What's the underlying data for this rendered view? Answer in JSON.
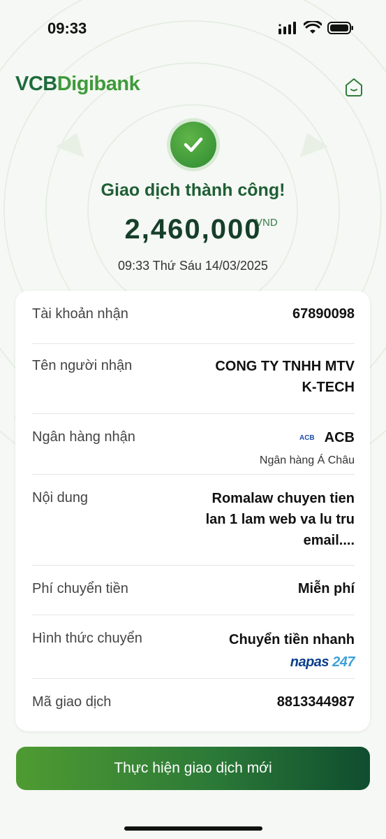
{
  "status_bar": {
    "time": "09:33",
    "icons": [
      "signal-icon",
      "wifi-icon",
      "battery-icon"
    ]
  },
  "header": {
    "logo_vcb": "VCB",
    "logo_digibank": "Digibank",
    "home_icon": "home-icon"
  },
  "result": {
    "title": "Giao dịch thành công!",
    "amount": "2,460,000",
    "currency": "VND",
    "datetime": "09:33 Thứ Sáu 14/03/2025"
  },
  "details": {
    "account": {
      "label": "Tài khoản nhận",
      "value": "67890098"
    },
    "recipient": {
      "label": "Tên người nhận",
      "value_line1": "CONG TY TNHH MTV",
      "value_line2": "K-TECH"
    },
    "bank": {
      "label": "Ngân hàng nhận",
      "logo_text": "ACB",
      "value": "ACB",
      "sub": "Ngân hàng Á Châu"
    },
    "content": {
      "label": "Nội dung",
      "value_line1": "Romalaw chuyen tien",
      "value_line2": "lan 1 lam web va lu tru",
      "value_line3": "email...."
    },
    "fee": {
      "label": "Phí chuyển tiền",
      "value": "Miễn phí"
    },
    "method": {
      "label": "Hình thức chuyển",
      "value": "Chuyển tiền nhanh",
      "napas_a": "napas",
      "napas_b": "247"
    },
    "txn_id": {
      "label": "Mã giao dịch",
      "value": "8813344987"
    }
  },
  "actions": {
    "new_transaction": "Thực hiện giao dịch mới"
  },
  "colors": {
    "brand_green": "#1e6b3c",
    "accent_green": "#3f9a3b",
    "success": "#2f8a31"
  }
}
